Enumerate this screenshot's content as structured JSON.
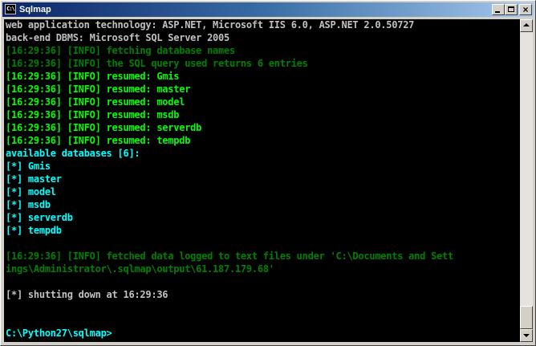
{
  "window": {
    "title": "Sqlmap",
    "icon_text": "C:\\"
  },
  "console": {
    "lines": [
      "web application technology: ASP.NET, Microsoft IIS 6.0, ASP.NET 2.0.50727",
      "back-end DBMS: Microsoft SQL Server 2005",
      "[16:29:36] [INFO] fetching database names",
      "[16:29:36] [INFO] the SQL query used returns 6 entries",
      "[16:29:36] [INFO] resumed: Gmis",
      "[16:29:36] [INFO] resumed: master",
      "[16:29:36] [INFO] resumed: model",
      "[16:29:36] [INFO] resumed: msdb",
      "[16:29:36] [INFO] resumed: serverdb",
      "[16:29:36] [INFO] resumed: tempdb",
      "available databases [6]:",
      "[*] Gmis",
      "[*] master",
      "[*] model",
      "[*] msdb",
      "[*] serverdb",
      "[*] tempdb",
      "",
      "[16:29:36] [INFO] fetched data logged to text files under 'C:\\Documents and Sett",
      "ings\\Administrator\\.sqlmap\\output\\61.187.179.68'",
      "",
      "[*] shutting down at 16:29:36",
      "",
      "",
      "C:\\Python27\\sqlmap>"
    ]
  },
  "colors": {
    "console_background": "#000000",
    "text_gray": "#c0c0c0",
    "text_green": "#008000",
    "text_bright_green": "#00ff00",
    "text_cyan": "#00ffff",
    "titlebar": "#0a246a"
  }
}
